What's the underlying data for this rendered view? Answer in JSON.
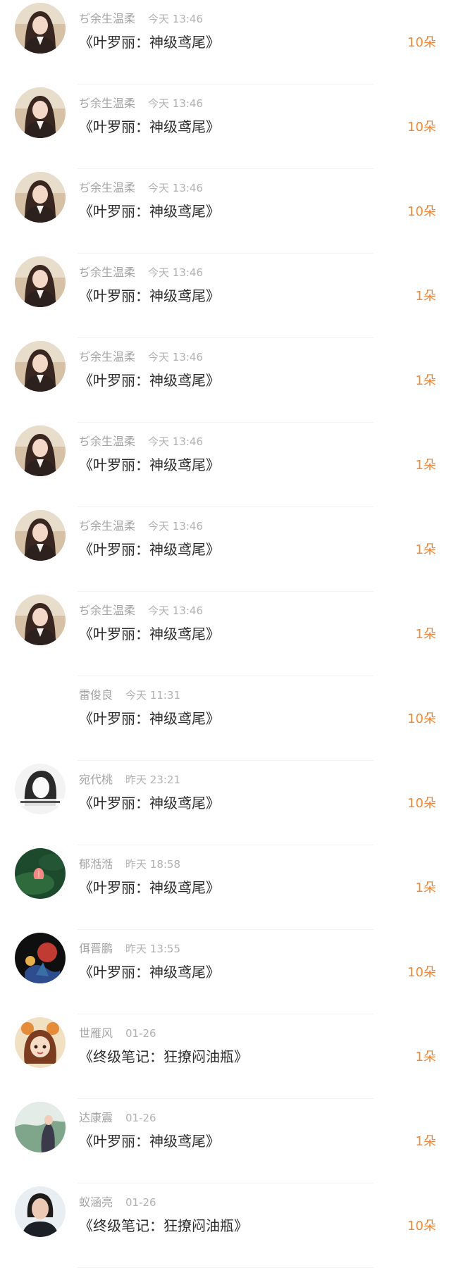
{
  "accent_color": "#f0883a",
  "rows": [
    {
      "avatar": "avatar-woman-long-hair",
      "name": "ぢ余生温柔",
      "time": "今天 13:46",
      "title": "《叶罗丽：神级鸢尾》",
      "amount": "10朵"
    },
    {
      "avatar": "avatar-woman-long-hair",
      "name": "ぢ余生温柔",
      "time": "今天 13:46",
      "title": "《叶罗丽：神级鸢尾》",
      "amount": "10朵"
    },
    {
      "avatar": "avatar-woman-long-hair",
      "name": "ぢ余生温柔",
      "time": "今天 13:46",
      "title": "《叶罗丽：神级鸢尾》",
      "amount": "10朵"
    },
    {
      "avatar": "avatar-woman-long-hair",
      "name": "ぢ余生温柔",
      "time": "今天 13:46",
      "title": "《叶罗丽：神级鸢尾》",
      "amount": "1朵"
    },
    {
      "avatar": "avatar-woman-long-hair",
      "name": "ぢ余生温柔",
      "time": "今天 13:46",
      "title": "《叶罗丽：神级鸢尾》",
      "amount": "1朵"
    },
    {
      "avatar": "avatar-woman-long-hair",
      "name": "ぢ余生温柔",
      "time": "今天 13:46",
      "title": "《叶罗丽：神级鸢尾》",
      "amount": "1朵"
    },
    {
      "avatar": "avatar-woman-long-hair",
      "name": "ぢ余生温柔",
      "time": "今天 13:46",
      "title": "《叶罗丽：神级鸢尾》",
      "amount": "1朵"
    },
    {
      "avatar": "avatar-woman-long-hair",
      "name": "ぢ余生温柔",
      "time": "今天 13:46",
      "title": "《叶罗丽：神级鸢尾》",
      "amount": "1朵"
    },
    {
      "avatar": "none",
      "name": "雷俊良",
      "time": "今天 11:31",
      "title": "《叶罗丽：神级鸢尾》",
      "amount": "10朵"
    },
    {
      "avatar": "avatar-bw-illustration",
      "name": "宛代桃",
      "time": "昨天 23:21",
      "title": "《叶罗丽：神级鸢尾》",
      "amount": "10朵"
    },
    {
      "avatar": "avatar-lotus-green",
      "name": "郁湉湉",
      "time": "昨天 18:58",
      "title": "《叶罗丽：神级鸢尾》",
      "amount": "1朵"
    },
    {
      "avatar": "avatar-dark-art",
      "name": "佴晋鹏",
      "time": "昨天 13:55",
      "title": "《叶罗丽：神级鸢尾》",
      "amount": "10朵"
    },
    {
      "avatar": "avatar-cartoon-girl",
      "name": "世雁风",
      "time": "01-26",
      "title": "《终级笔记：狂撩闷油瓶》",
      "amount": "1朵"
    },
    {
      "avatar": "avatar-outdoor-woman",
      "name": "达康震",
      "time": "01-26",
      "title": "《叶罗丽：神级鸢尾》",
      "amount": "1朵"
    },
    {
      "avatar": "avatar-portrait-woman",
      "name": "蚁涵亮",
      "time": "01-26",
      "title": "《终级笔记：狂撩闷油瓶》",
      "amount": "10朵"
    }
  ]
}
